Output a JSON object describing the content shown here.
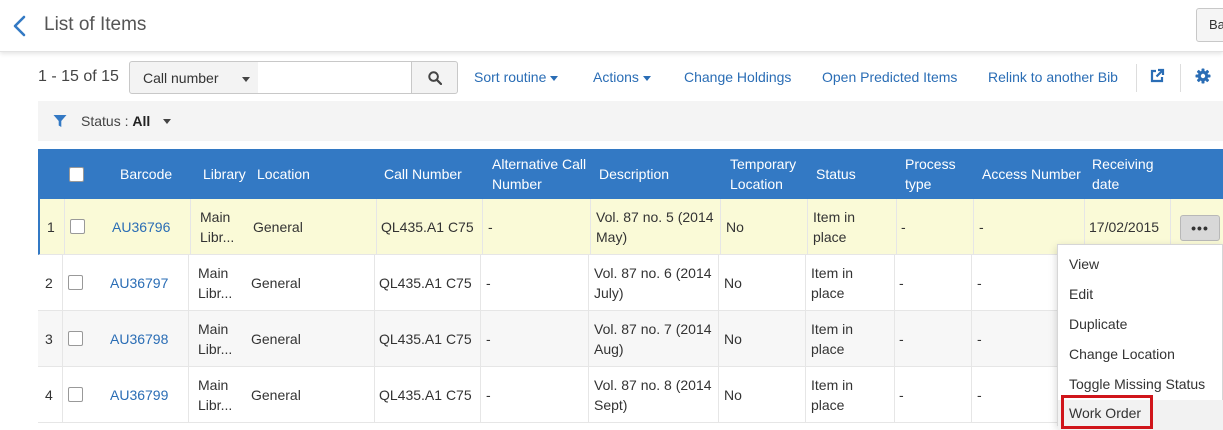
{
  "header": {
    "title": "List of Items",
    "right_button_label": "Ba"
  },
  "toolbar": {
    "result_count": "1 - 15 of 15",
    "search_field": "Call number",
    "search_value": "",
    "links": {
      "sort_routine": "Sort routine",
      "actions": "Actions",
      "change_holdings": "Change Holdings",
      "open_predicted_items": "Open Predicted Items",
      "relink": "Relink to another Bib"
    },
    "icons": [
      "search-icon",
      "external-link-icon",
      "gear-icon"
    ]
  },
  "filter": {
    "label": "Status :",
    "value": "All",
    "icon": "filter-icon"
  },
  "table": {
    "headers": {
      "barcode": "Barcode",
      "library": "Library",
      "location": "Location",
      "call_number": "Call Number",
      "alt_call_number_1": "Alternative Call",
      "alt_call_number_2": "Number",
      "description": "Description",
      "temp_location_1": "Temporary",
      "temp_location_2": "Location",
      "status": "Status",
      "process_type_1": "Process",
      "process_type_2": "type",
      "access_number": "Access Number",
      "receiving_date_1": "Receiving",
      "receiving_date_2": "date"
    },
    "rows": [
      {
        "num": "1",
        "barcode": "AU36796",
        "library_1": "Main",
        "library_2": "Libr...",
        "location": "General",
        "call_number": "QL435.A1 C75",
        "alt_call_number": "-",
        "description_1": "Vol. 87 no. 5 (2014",
        "description_2": "May)",
        "temp_location": "No",
        "status_1": "Item in",
        "status_2": "place",
        "process_type": "-",
        "access_number": "-",
        "receiving_date": "17/02/2015"
      },
      {
        "num": "2",
        "barcode": "AU36797",
        "library_1": "Main",
        "library_2": "Libr...",
        "location": "General",
        "call_number": "QL435.A1 C75",
        "alt_call_number": "-",
        "description_1": "Vol. 87 no. 6 (2014",
        "description_2": "July)",
        "temp_location": "No",
        "status_1": "Item in",
        "status_2": "place",
        "process_type": "-",
        "access_number": "-",
        "receiving_date": ""
      },
      {
        "num": "3",
        "barcode": "AU36798",
        "library_1": "Main",
        "library_2": "Libr...",
        "location": "General",
        "call_number": "QL435.A1 C75",
        "alt_call_number": "-",
        "description_1": "Vol. 87 no. 7 (2014",
        "description_2": "Aug)",
        "temp_location": "No",
        "status_1": "Item in",
        "status_2": "place",
        "process_type": "-",
        "access_number": "-",
        "receiving_date": ""
      },
      {
        "num": "4",
        "barcode": "AU36799",
        "library_1": "Main",
        "library_2": "Libr...",
        "location": "General",
        "call_number": "QL435.A1 C75",
        "alt_call_number": "-",
        "description_1": "Vol. 87 no. 8 (2014",
        "description_2": "Sept)",
        "temp_location": "No",
        "status_1": "Item in",
        "status_2": "place",
        "process_type": "-",
        "access_number": "-",
        "receiving_date": ""
      }
    ]
  },
  "row_menu": {
    "items": [
      "View",
      "Edit",
      "Duplicate",
      "Change Location",
      "Toggle Missing Status",
      "Work Order"
    ],
    "highlighted_item": "Work Order"
  },
  "colors": {
    "header_blue": "#3379c4",
    "link_blue": "#2a6db5",
    "selected_row": "#fafad7",
    "highlight_box": "#d0151b"
  }
}
